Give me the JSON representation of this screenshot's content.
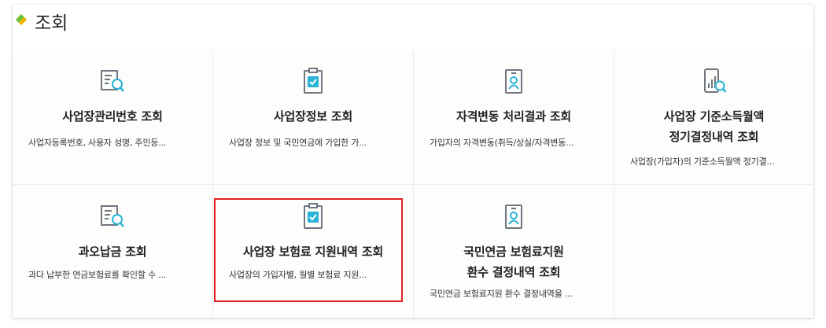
{
  "header": {
    "title": "조회",
    "bullet_colors": [
      "#f0b400",
      "#6cbf3a"
    ]
  },
  "cards": [
    {
      "icon": "document-search-icon",
      "title_lines": [
        "사업장관리번호 조회"
      ],
      "description": "사업자등록번호, 사용자 성명, 주민등..."
    },
    {
      "icon": "clipboard-check-icon",
      "title_lines": [
        "사업장정보 조회"
      ],
      "description": "사업장 정보 및 국민연금에 가입한 가..."
    },
    {
      "icon": "id-card-person-icon",
      "title_lines": [
        "자격변동 처리결과 조회"
      ],
      "description": "가입자의 자격변동(취득/상실/자격변동..."
    },
    {
      "icon": "mobile-chart-search-icon",
      "title_lines": [
        "사업장 기준소득월액",
        "정기결정내역 조회"
      ],
      "description": "사업장(가입자)의 기준소득월액 정기결..."
    },
    {
      "icon": "document-search-icon",
      "title_lines": [
        "과오납금 조회"
      ],
      "description": "과다 납부한 연금보험료를 확인할 수 ..."
    },
    {
      "icon": "clipboard-check-icon",
      "title_lines": [
        "사업장 보험료 지원내역 조회"
      ],
      "description": "사업장의 가입자별, 월별 보험료 지원..."
    },
    {
      "icon": "id-card-person-icon",
      "title_lines": [
        "국민연금 보험료지원",
        "환수 결정내역 조회"
      ],
      "description": "국민연금 보험료지원 환수 결정내역을 ..."
    }
  ],
  "colors": {
    "icon_gray": "#6f7680",
    "icon_accent": "#29b3d6",
    "highlight_border": "#e02020"
  }
}
